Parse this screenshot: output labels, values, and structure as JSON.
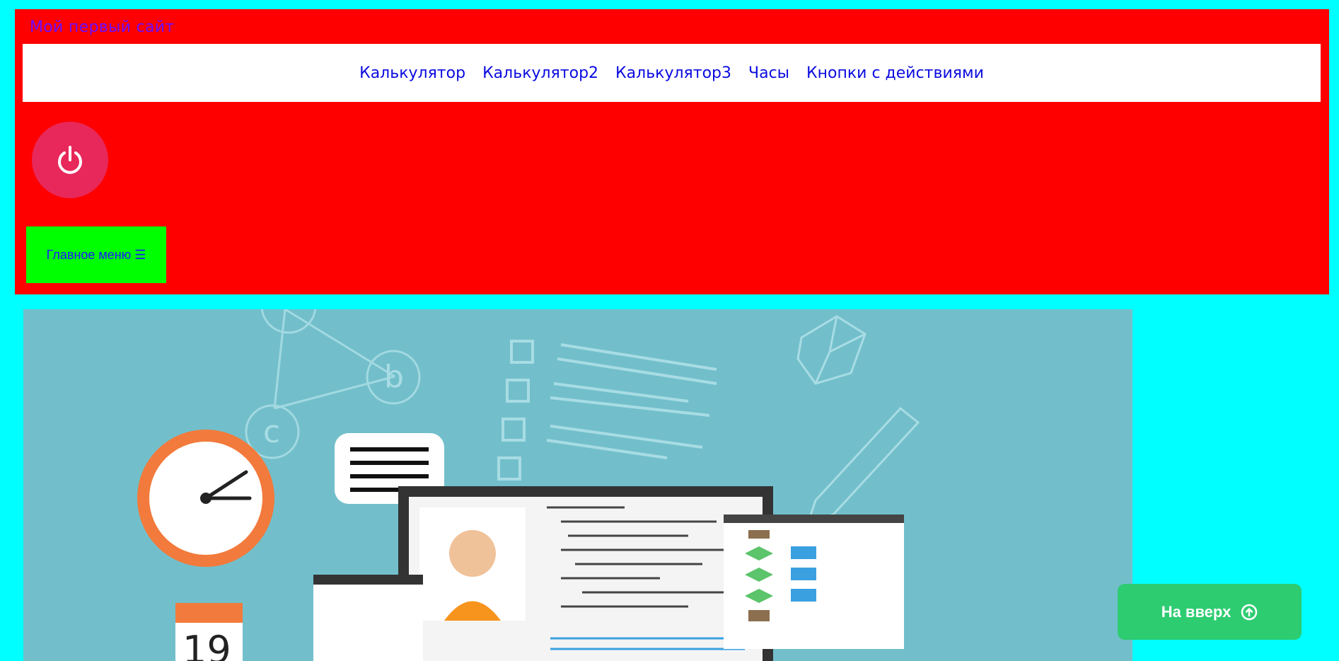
{
  "site": {
    "title": "Мой первый сайт"
  },
  "nav": {
    "items": [
      {
        "label": "Калькулятор"
      },
      {
        "label": "Калькулятор2"
      },
      {
        "label": "Калькулятор3"
      },
      {
        "label": "Часы"
      },
      {
        "label": "Кнопки с действиями"
      }
    ]
  },
  "controls": {
    "power_icon": "power-icon",
    "main_menu_label": "Главное меню ☰",
    "back_to_top_label": "На вверх",
    "back_to_top_icon": "arrow-up-circle-icon"
  },
  "hero": {
    "calendar_day": "19",
    "graph_nodes": [
      "b",
      "c"
    ]
  },
  "colors": {
    "page_bg": "#00ffff",
    "header_bg": "#ff0000",
    "nav_bg": "#ffffff",
    "nav_link": "#0b0be0",
    "power_button": "#e8285a",
    "menu_button": "#00ff00",
    "back_to_top_button": "#2ecc71",
    "hero_bg": "#72bfcb"
  }
}
